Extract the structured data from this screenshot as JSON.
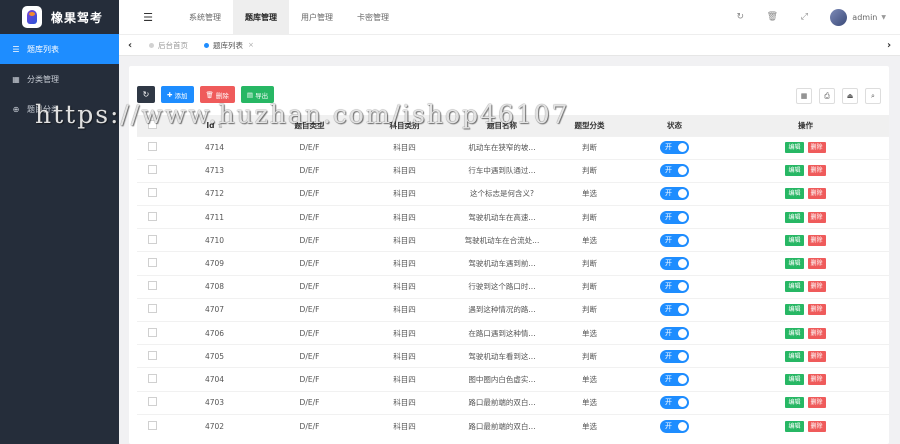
{
  "app": {
    "name": "橡果驾考"
  },
  "sidebar": {
    "items": [
      {
        "label": "题库列表",
        "icon": "list-icon",
        "active": true
      },
      {
        "label": "分类管理",
        "icon": "calendar-icon",
        "active": false
      },
      {
        "label": "题目分类",
        "icon": "circle-plus-icon",
        "active": false
      }
    ]
  },
  "header": {
    "toggle_icon": "☰",
    "nav": [
      "系统管理",
      "题库管理",
      "用户管理",
      "卡密管理"
    ],
    "active_nav": "题库管理",
    "user": "admin"
  },
  "tabs": [
    {
      "label": "后台首页",
      "active": false
    },
    {
      "label": "题库列表",
      "active": true,
      "close": "×"
    }
  ],
  "toolbar": {
    "add": "添加",
    "delete": "删除",
    "export": "导出"
  },
  "table": {
    "columns": [
      "",
      "Id",
      "题目类型",
      "科目类别",
      "题目名称",
      "题型分类",
      "状态",
      "操作"
    ],
    "switch_label": "开",
    "edit_label": "编辑",
    "delete_label": "删除",
    "rows": [
      [
        "4714",
        "D/E/F",
        "科目四",
        "机动车在狭窄的坡...",
        "判断"
      ],
      [
        "4713",
        "D/E/F",
        "科目四",
        "行车中遇到队通过...",
        "判断"
      ],
      [
        "4712",
        "D/E/F",
        "科目四",
        "这个标志是何含义?",
        "单选"
      ],
      [
        "4711",
        "D/E/F",
        "科目四",
        "驾驶机动车在高速...",
        "判断"
      ],
      [
        "4710",
        "D/E/F",
        "科目四",
        "驾驶机动车在合流处...",
        "单选"
      ],
      [
        "4709",
        "D/E/F",
        "科目四",
        "驾驶机动车遇到前...",
        "判断"
      ],
      [
        "4708",
        "D/E/F",
        "科目四",
        "行驶到这个路口时...",
        "判断"
      ],
      [
        "4707",
        "D/E/F",
        "科目四",
        "遇到这种情况的路...",
        "判断"
      ],
      [
        "4706",
        "D/E/F",
        "科目四",
        "在路口遇到这种情...",
        "单选"
      ],
      [
        "4705",
        "D/E/F",
        "科目四",
        "驾驶机动车看到这...",
        "判断"
      ],
      [
        "4704",
        "D/E/F",
        "科目四",
        "图中圈内白色虚实...",
        "单选"
      ],
      [
        "4703",
        "D/E/F",
        "科目四",
        "路口最前端的双白...",
        "单选"
      ],
      [
        "4702",
        "D/E/F",
        "科目四",
        "路口最前端的双白...",
        "单选"
      ]
    ]
  },
  "watermark": "https://www.huzhan.com/ishop46107",
  "colors": {
    "primary": "#1e8dff",
    "sidebar": "#252d3a",
    "danger": "#ef5b5b",
    "success": "#27b764"
  }
}
